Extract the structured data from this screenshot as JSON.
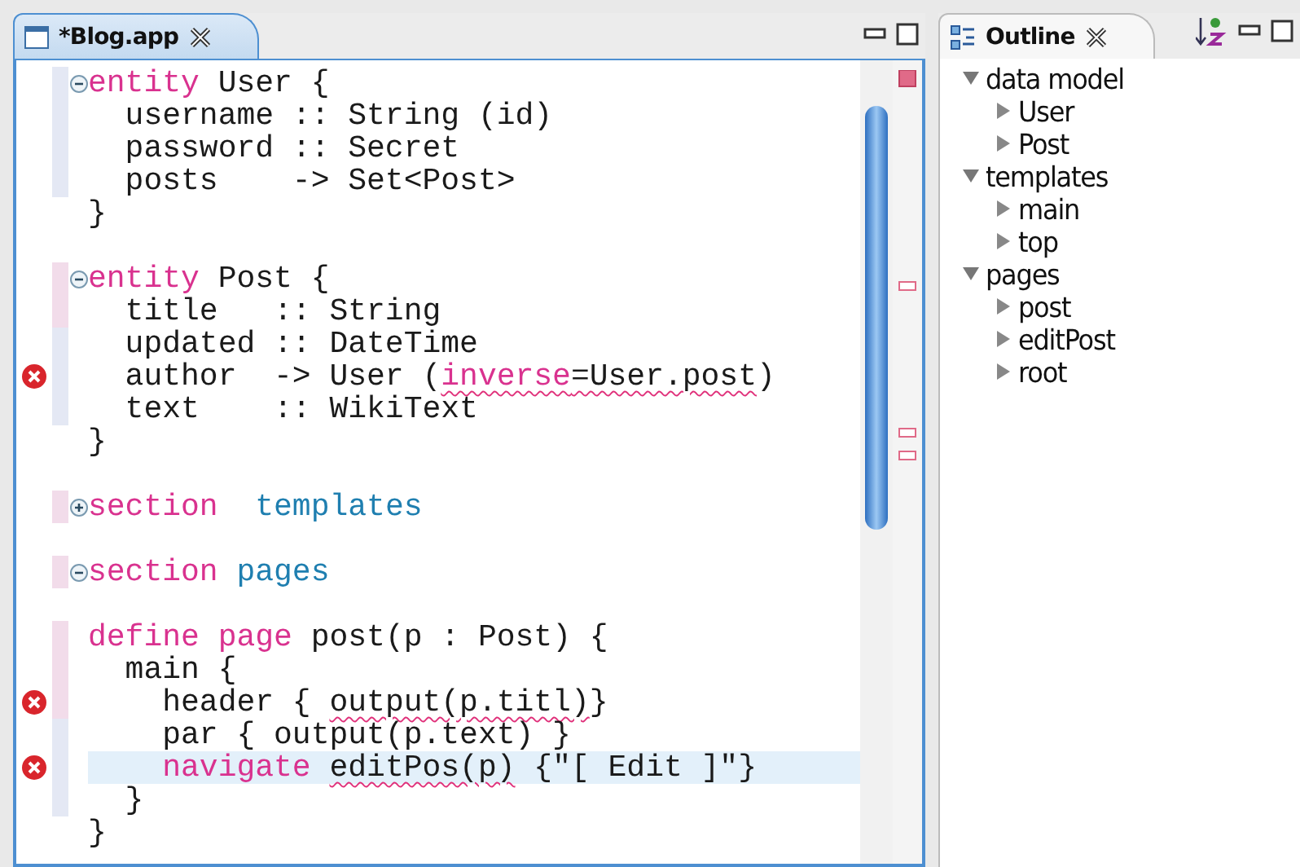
{
  "editor": {
    "tab": {
      "title": "*Blog.app",
      "selected": true
    },
    "lines": [
      {
        "foldable": true,
        "collapsed": false,
        "color": "#e4e8f4",
        "tokens": [
          {
            "text": "entity",
            "kind": "keyword"
          },
          {
            "text": " User {",
            "kind": "plain"
          }
        ]
      },
      {
        "color": "#e4e8f4",
        "tokens": [
          {
            "text": "  username :: String (id)",
            "kind": "plain"
          }
        ]
      },
      {
        "color": "#e4e8f4",
        "tokens": [
          {
            "text": "  password :: Secret",
            "kind": "plain"
          }
        ]
      },
      {
        "color": "#e4e8f4",
        "tokens": [
          {
            "text": "  posts    -> Set<Post>",
            "kind": "plain"
          }
        ]
      },
      {
        "tokens": [
          {
            "text": "}",
            "kind": "plain"
          }
        ]
      },
      {
        "space_before": true,
        "foldable": true,
        "collapsed": false,
        "color": "#f2dcea",
        "tokens": [
          {
            "text": "entity",
            "kind": "keyword"
          },
          {
            "text": " Post {",
            "kind": "plain"
          }
        ]
      },
      {
        "color": "#f2dcea",
        "tokens": [
          {
            "text": "  title   :: String",
            "kind": "plain"
          }
        ]
      },
      {
        "color": "#e4e8f4",
        "tokens": [
          {
            "text": "  updated :: DateTime",
            "kind": "plain"
          }
        ]
      },
      {
        "error": true,
        "color": "#e4e8f4",
        "tokens": [
          {
            "text": "  author  -> User (",
            "kind": "plain"
          },
          {
            "text": "inverse",
            "kind": "keyword",
            "squiggle": true
          },
          {
            "text": "=User.post",
            "kind": "plain",
            "squiggle": true
          },
          {
            "text": ")",
            "kind": "plain"
          }
        ]
      },
      {
        "color": "#e4e8f4",
        "tokens": [
          {
            "text": "  text    :: WikiText",
            "kind": "plain"
          }
        ]
      },
      {
        "tokens": [
          {
            "text": "}",
            "kind": "plain"
          }
        ]
      },
      {
        "space_before": true,
        "foldable": true,
        "collapsed": true,
        "color": "#f2dcea",
        "tokens": [
          {
            "text": "section",
            "kind": "keyword"
          },
          {
            "text": "  templates",
            "kind": "name"
          }
        ]
      },
      {
        "space_before": true,
        "foldable": true,
        "collapsed": false,
        "color": "#f2dcea",
        "tokens": [
          {
            "text": "section",
            "kind": "keyword"
          },
          {
            "text": " pages",
            "kind": "name"
          }
        ]
      },
      {
        "space_before": true,
        "color": "#f2dcea",
        "tokens": [
          {
            "text": "define",
            "kind": "keyword"
          },
          {
            "text": " page",
            "kind": "keyword"
          },
          {
            "text": " post(p : Post) {",
            "kind": "plain"
          }
        ]
      },
      {
        "color": "#f2dcea",
        "tokens": [
          {
            "text": "  main {",
            "kind": "plain"
          }
        ]
      },
      {
        "error": true,
        "color": "#f2dcea",
        "tokens": [
          {
            "text": "    header { ",
            "kind": "plain"
          },
          {
            "text": "output(p.titl)",
            "kind": "plain",
            "squiggle": true
          },
          {
            "text": "}",
            "kind": "plain"
          }
        ]
      },
      {
        "color": "#e4e8f4",
        "tokens": [
          {
            "text": "    par { output(p.text) }",
            "kind": "plain"
          }
        ]
      },
      {
        "error": true,
        "color": "#e4e8f4",
        "current": true,
        "tokens": [
          {
            "text": "    navigate ",
            "kind": "keyword"
          },
          {
            "text": "editPos(p)",
            "kind": "plain",
            "squiggle": true
          },
          {
            "text": " {\"[ Edit ]\"}",
            "kind": "plain"
          }
        ]
      },
      {
        "color": "#e4e8f4",
        "tokens": [
          {
            "text": "  }",
            "kind": "plain"
          }
        ]
      },
      {
        "tokens": [
          {
            "text": "}",
            "kind": "plain"
          }
        ]
      }
    ]
  },
  "outline": {
    "tab": {
      "title": "Outline",
      "selected": false
    },
    "items": [
      {
        "label": "data model",
        "expanded": true,
        "children": [
          {
            "label": "User",
            "expanded": false
          },
          {
            "label": "Post",
            "expanded": false
          }
        ]
      },
      {
        "label": "templates",
        "expanded": true,
        "children": [
          {
            "label": "main",
            "expanded": false
          },
          {
            "label": "top",
            "expanded": false
          }
        ]
      },
      {
        "label": "pages",
        "expanded": true,
        "children": [
          {
            "label": "post",
            "expanded": false
          },
          {
            "label": "editPost",
            "expanded": false
          },
          {
            "label": "root",
            "expanded": false
          }
        ]
      }
    ]
  }
}
